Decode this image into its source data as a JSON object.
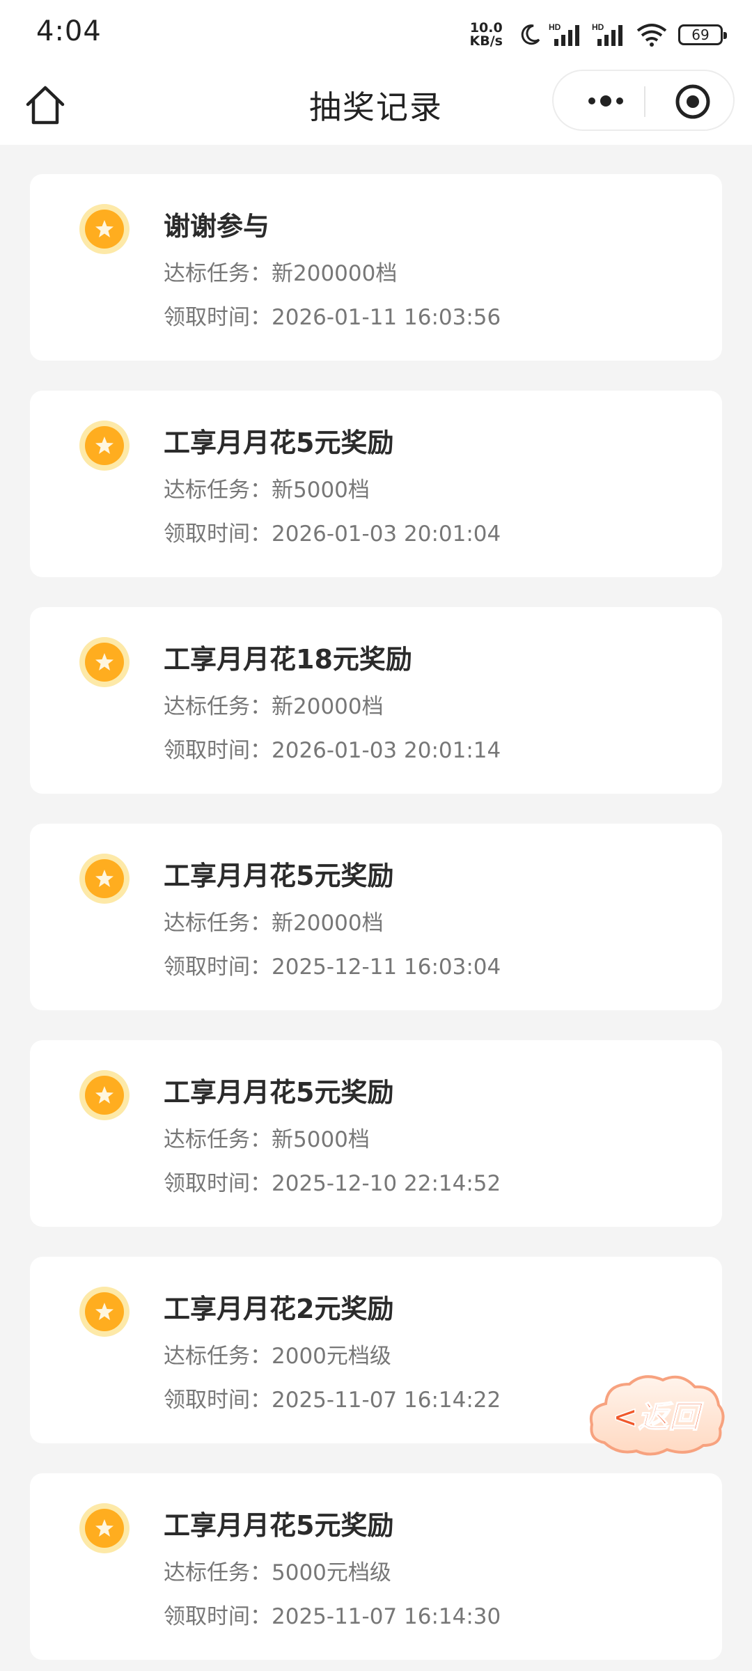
{
  "status_bar": {
    "time": "4:04",
    "net_speed_value": "10.0",
    "net_speed_unit": "KB/s",
    "signal_label_1": "HD",
    "signal_label_2": "HD",
    "battery": "69"
  },
  "nav": {
    "title": "抽奖记录"
  },
  "records": [
    {
      "title": "谢谢参与",
      "task_label": "达标任务：",
      "task": "新200000档",
      "time_label": "领取时间：",
      "time": "2026-01-11 16:03:56"
    },
    {
      "title": "工享月月花5元奖励",
      "task_label": "达标任务：",
      "task": "新5000档",
      "time_label": "领取时间：",
      "time": "2026-01-03 20:01:04"
    },
    {
      "title": "工享月月花18元奖励",
      "task_label": "达标任务：",
      "task": "新20000档",
      "time_label": "领取时间：",
      "time": "2026-01-03 20:01:14"
    },
    {
      "title": "工享月月花5元奖励",
      "task_label": "达标任务：",
      "task": "新20000档",
      "time_label": "领取时间：",
      "time": "2025-12-11 16:03:04"
    },
    {
      "title": "工享月月花5元奖励",
      "task_label": "达标任务：",
      "task": "新5000档",
      "time_label": "领取时间：",
      "time": "2025-12-10 22:14:52"
    },
    {
      "title": "工享月月花2元奖励",
      "task_label": "达标任务：",
      "task": "2000元档级",
      "time_label": "领取时间：",
      "time": "2025-11-07 16:14:22"
    },
    {
      "title": "工享月月花5元奖励",
      "task_label": "达标任务：",
      "task": "5000元档级",
      "time_label": "领取时间：",
      "time": "2025-11-07 16:14:30"
    }
  ],
  "floating_button": {
    "label": "<返回",
    "icon": "cloud-back-icon"
  },
  "colors": {
    "coin_outer": "#fde9a8",
    "coin_inner": "#ffad1f",
    "back_text": "#f0592c"
  }
}
